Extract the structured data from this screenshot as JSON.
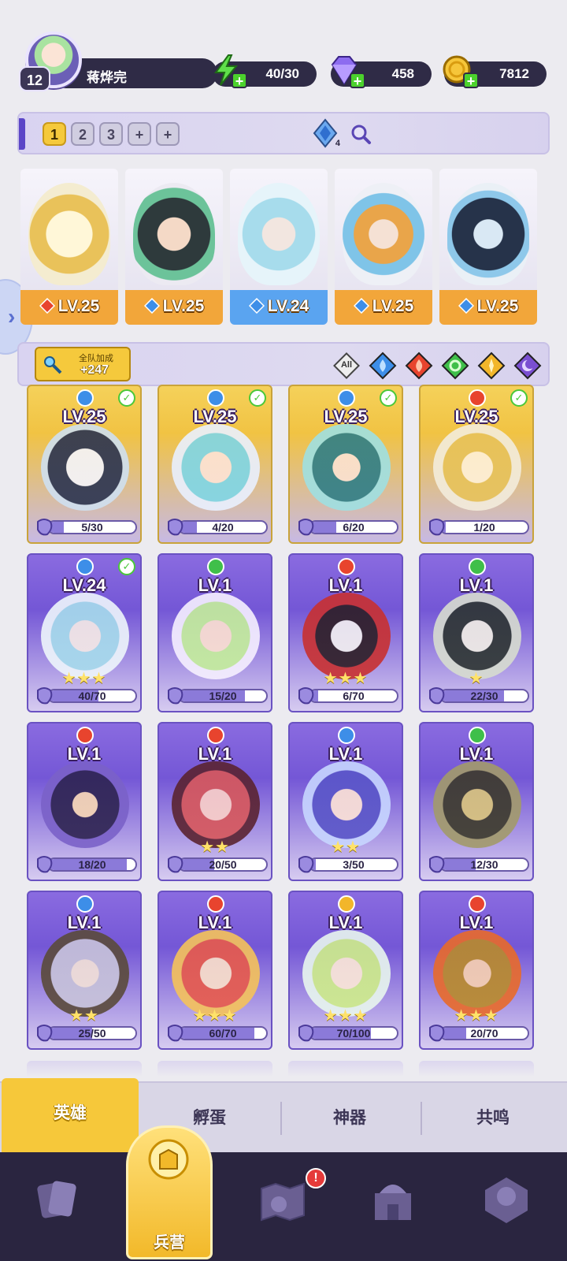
{
  "player": {
    "level": "12",
    "name": "蒋烨完"
  },
  "resources": {
    "energy": {
      "icon": "lightning-icon",
      "value": "40/30"
    },
    "gems": {
      "icon": "gem-icon",
      "value": "458"
    },
    "coins": {
      "icon": "coin-icon",
      "value": "7812"
    }
  },
  "teams": {
    "tabs": [
      "1",
      "2",
      "3",
      "+",
      "+"
    ],
    "active": "1",
    "power_count": "4"
  },
  "team_slots": [
    {
      "level": "LV.25",
      "element": "fire",
      "rarity": "orange"
    },
    {
      "level": "LV.25",
      "element": "water",
      "rarity": "orange"
    },
    {
      "level": "LV.24",
      "element": "water",
      "rarity": "blue"
    },
    {
      "level": "LV.25",
      "element": "water",
      "rarity": "orange"
    },
    {
      "level": "LV.25",
      "element": "water",
      "rarity": "orange"
    }
  ],
  "filter": {
    "bonus_label": "全队加成",
    "bonus_value": "+247",
    "options": [
      "All",
      "water",
      "fire",
      "wind",
      "light",
      "dark"
    ]
  },
  "colors": {
    "water": "#3d8ee8",
    "fire": "#e8442e",
    "wind": "#3fbf4a",
    "light": "#f2b62a",
    "dark": "#7a4fd1",
    "accent": "#f5c93c"
  },
  "heroes": [
    {
      "level": "LV.25",
      "element": "water",
      "shards": "5/30",
      "progress": 0.17,
      "stars": "",
      "owned": true,
      "frame": "gold"
    },
    {
      "level": "LV.25",
      "element": "water",
      "shards": "4/20",
      "progress": 0.2,
      "stars": "",
      "owned": true,
      "frame": "gold"
    },
    {
      "level": "LV.25",
      "element": "water",
      "shards": "6/20",
      "progress": 0.3,
      "stars": "",
      "owned": true,
      "frame": "gold"
    },
    {
      "level": "LV.25",
      "element": "fire",
      "shards": "1/20",
      "progress": 0.05,
      "stars": "",
      "owned": true,
      "frame": "gold"
    },
    {
      "level": "LV.24",
      "element": "water",
      "shards": "40/70",
      "progress": 0.57,
      "stars": "★★★",
      "owned": true,
      "frame": "purple"
    },
    {
      "level": "LV.1",
      "element": "wind",
      "shards": "15/20",
      "progress": 0.75,
      "stars": "",
      "owned": false,
      "frame": "purple"
    },
    {
      "level": "LV.1",
      "element": "fire",
      "shards": "6/70",
      "progress": 0.09,
      "stars": "★★★",
      "owned": false,
      "frame": "purple"
    },
    {
      "level": "LV.1",
      "element": "wind",
      "shards": "22/30",
      "progress": 0.73,
      "stars": "★",
      "owned": false,
      "frame": "purple"
    },
    {
      "level": "LV.1",
      "element": "fire",
      "shards": "18/20",
      "progress": 0.9,
      "stars": "",
      "owned": false,
      "frame": "purple"
    },
    {
      "level": "LV.1",
      "element": "fire",
      "shards": "20/50",
      "progress": 0.4,
      "stars": "★★",
      "owned": false,
      "frame": "purple"
    },
    {
      "level": "LV.1",
      "element": "water",
      "shards": "3/50",
      "progress": 0.06,
      "stars": "★★",
      "owned": false,
      "frame": "purple"
    },
    {
      "level": "LV.1",
      "element": "wind",
      "shards": "12/30",
      "progress": 0.4,
      "stars": "",
      "owned": false,
      "frame": "purple"
    },
    {
      "level": "LV.1",
      "element": "water",
      "shards": "25/50",
      "progress": 0.5,
      "stars": "★★",
      "owned": false,
      "frame": "purple"
    },
    {
      "level": "LV.1",
      "element": "fire",
      "shards": "60/70",
      "progress": 0.86,
      "stars": "★★★",
      "owned": false,
      "frame": "purple"
    },
    {
      "level": "LV.1",
      "element": "light",
      "shards": "70/100",
      "progress": 0.7,
      "stars": "★★★",
      "owned": false,
      "frame": "purple"
    },
    {
      "level": "LV.1",
      "element": "fire",
      "shards": "20/70",
      "progress": 0.29,
      "stars": "★★★",
      "owned": false,
      "frame": "purple"
    }
  ],
  "subtabs": [
    "英雄",
    "孵蛋",
    "神器",
    "共鸣"
  ],
  "bottom_nav": {
    "items": [
      "cards-icon",
      "barracks-icon",
      "map-icon",
      "castle-icon",
      "guild-icon"
    ],
    "center_label": "兵营",
    "notification": "!"
  }
}
